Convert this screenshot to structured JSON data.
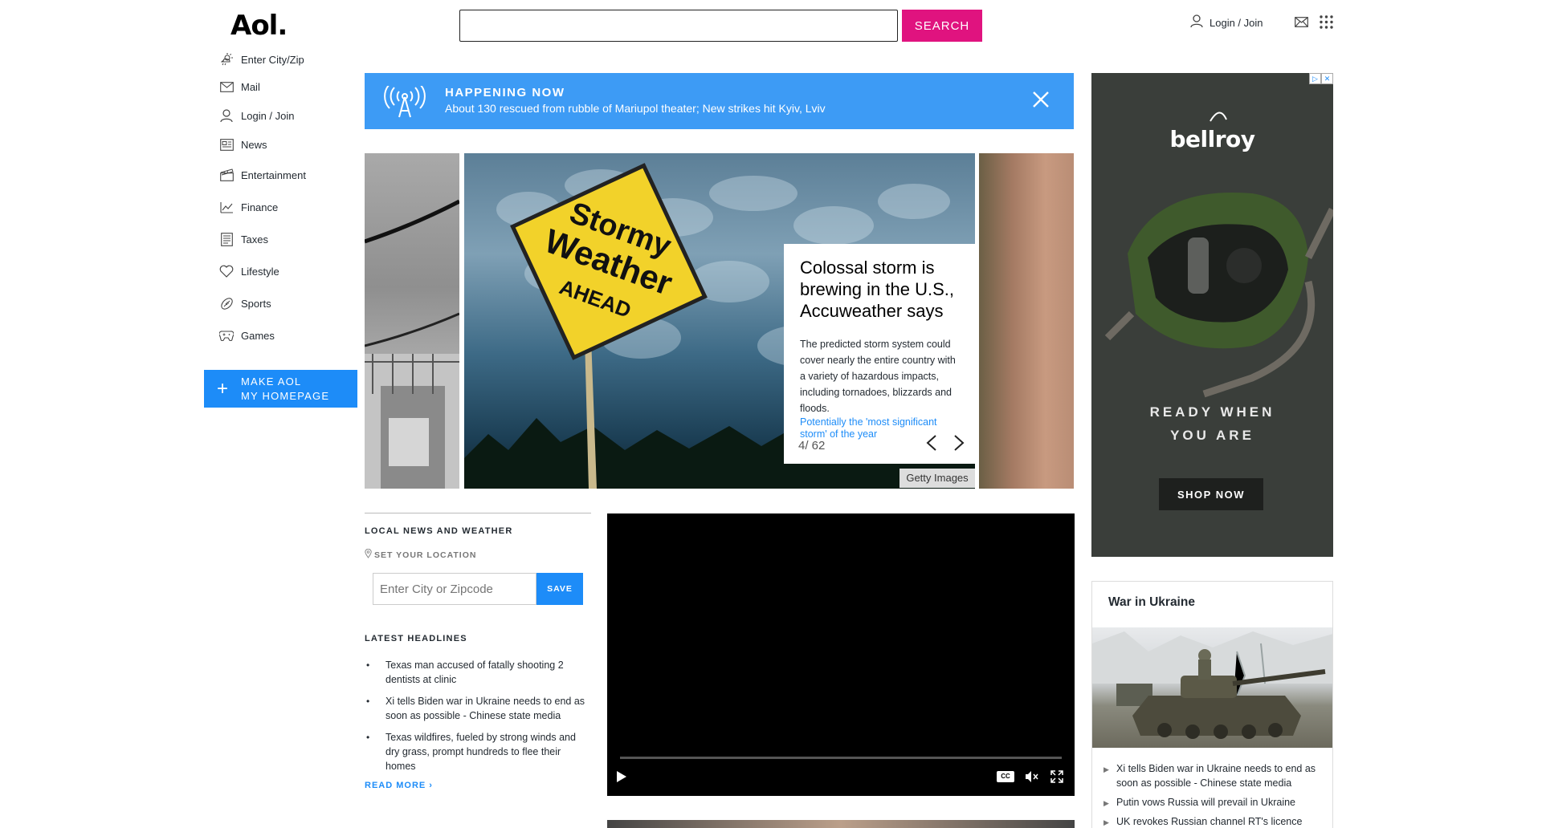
{
  "header": {
    "logo": "Aol.",
    "search_placeholder": "",
    "search_button": "SEARCH",
    "login_label": "Login / Join"
  },
  "sidebar": {
    "items": [
      {
        "label": "Enter City/Zip",
        "icon": "weather-icon"
      },
      {
        "label": "Mail",
        "icon": "mail-icon"
      },
      {
        "label": "Login / Join",
        "icon": "user-icon"
      },
      {
        "label": "News",
        "icon": "news-icon"
      },
      {
        "label": "Entertainment",
        "icon": "clapper-icon"
      },
      {
        "label": "Finance",
        "icon": "finance-icon"
      },
      {
        "label": "Taxes",
        "icon": "taxes-icon"
      },
      {
        "label": "Lifestyle",
        "icon": "heart-icon"
      },
      {
        "label": "Sports",
        "icon": "football-icon"
      },
      {
        "label": "Games",
        "icon": "gamepad-icon"
      }
    ],
    "make_homepage": [
      "MAKE AOL",
      "MY HOMEPAGE"
    ]
  },
  "banner": {
    "kicker": "HAPPENING NOW",
    "headline": "About 130 rescued from rubble of Mariupol theater; New strikes hit Kyiv, Lviv"
  },
  "carousel": {
    "sign_lines": [
      "Stormy",
      "Weather",
      "AHEAD"
    ],
    "title": "Colossal storm is brewing in the U.S., Accuweather says",
    "description": "The predicted storm system could cover nearly the entire country with a variety of hazardous impacts, including tornadoes, blizzards and floods.",
    "link": "Potentially the 'most significant storm' of the year",
    "counter": "4/ 62",
    "credit": "Getty Images"
  },
  "local": {
    "title": "LOCAL NEWS AND WEATHER",
    "set_location": "SET YOUR LOCATION",
    "input_placeholder": "Enter City or Zipcode",
    "save": "SAVE",
    "headlines_title": "LATEST HEADLINES",
    "headlines": [
      "Texas man accused of fatally shooting 2 dentists at clinic",
      "Xi tells Biden war in Ukraine needs to end as soon as possible - Chinese state media",
      "Texas wildfires, fueled by strong winds and dry grass, prompt hundreds to flee their homes"
    ],
    "read_more": "READ MORE ›"
  },
  "video": {
    "cc_label": "CC"
  },
  "ad": {
    "brand": "bellroy",
    "tagline": [
      "READY WHEN",
      "YOU ARE"
    ],
    "shop": "SHOP NOW"
  },
  "ukraine": {
    "title": "War in Ukraine",
    "items": [
      "Xi tells Biden war in Ukraine needs to end as soon as possible - Chinese state media",
      "Putin vows Russia will prevail in Ukraine",
      "UK revokes Russian channel RT's licence"
    ]
  },
  "colors": {
    "accent_pink": "#e0137f",
    "accent_blue": "#1d8cf8",
    "banner_blue": "#3d9bf5"
  }
}
